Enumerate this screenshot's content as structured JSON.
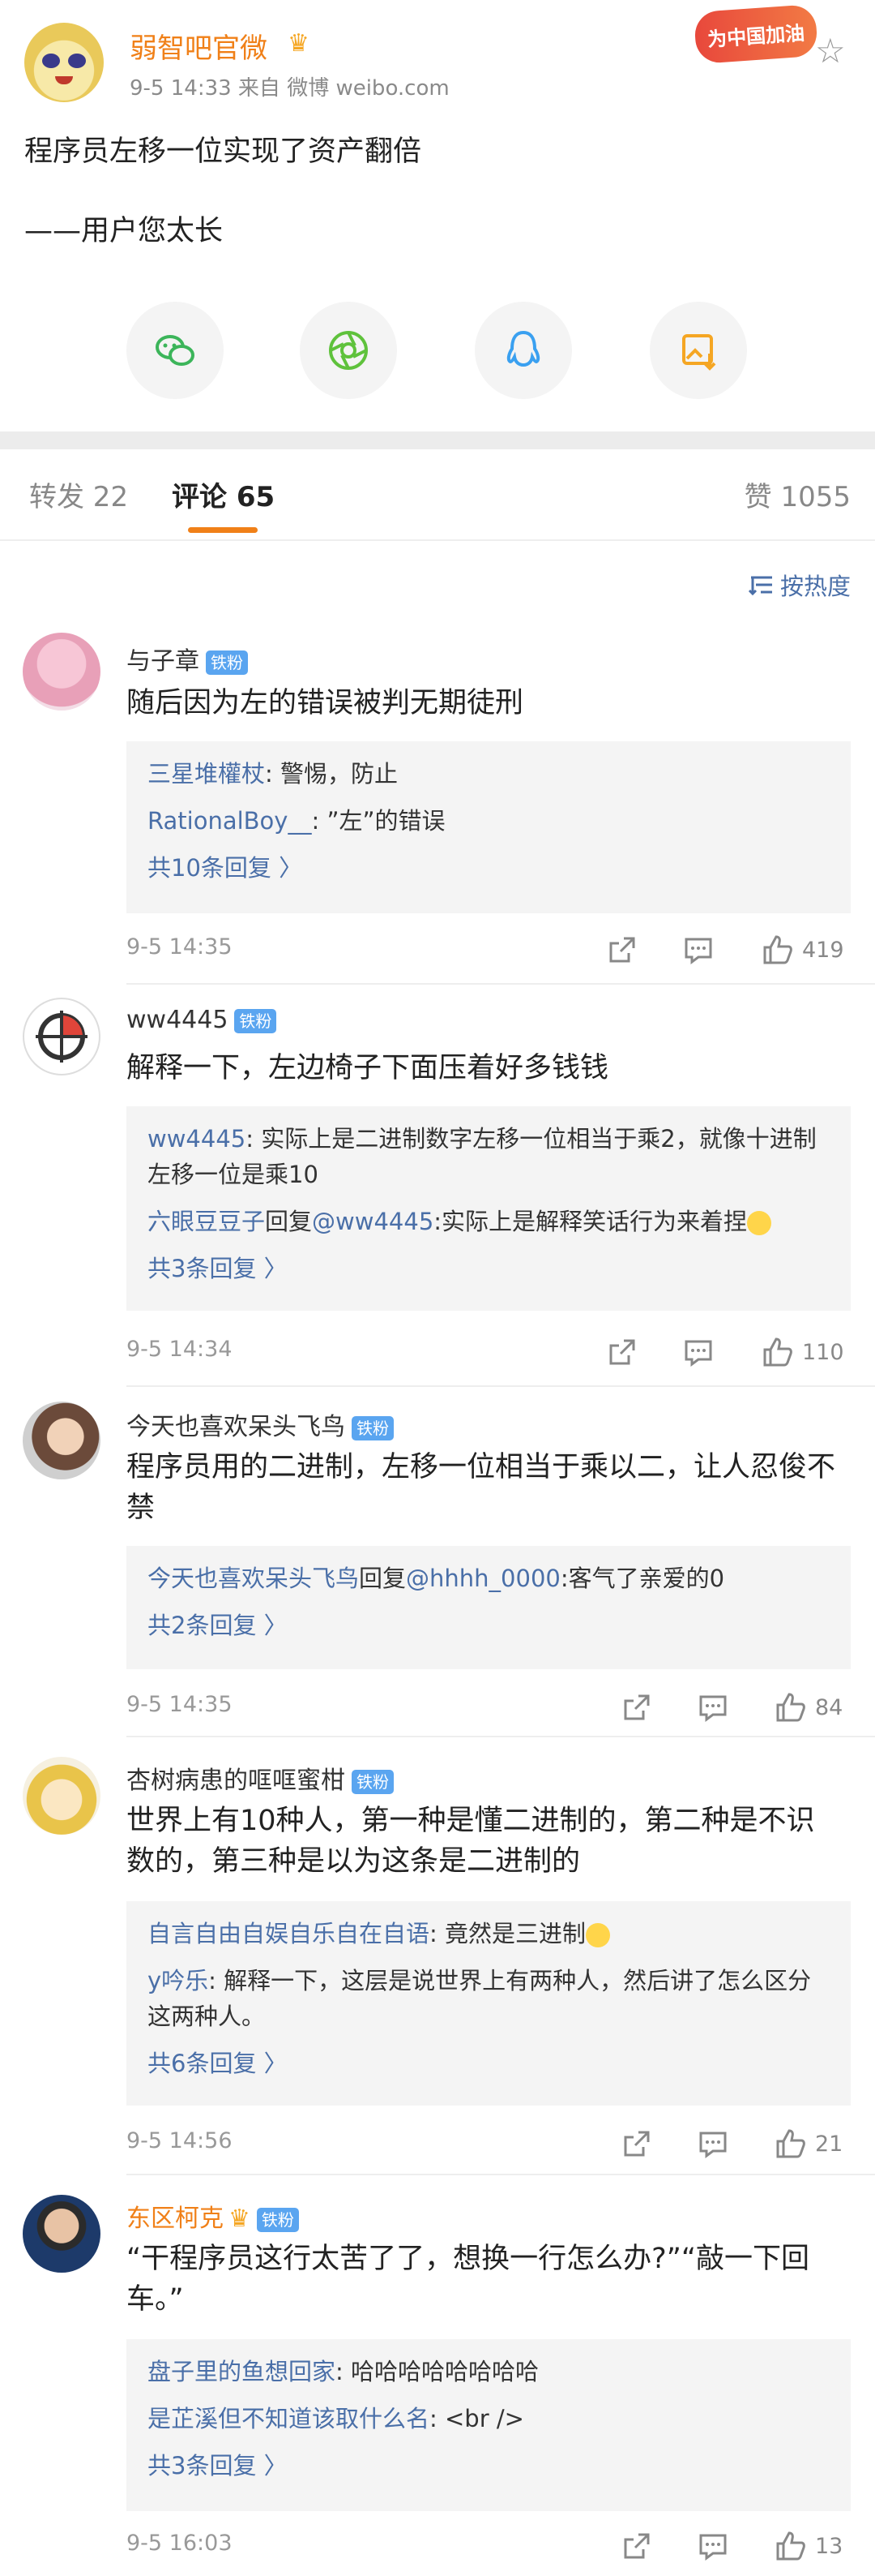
{
  "post": {
    "author": "弱智吧官微",
    "meta": "9-5 14:33   来自 微博 weibo.com",
    "badge": "为中国加油",
    "line1": "程序员左移一位实现了资产翻倍",
    "line2": "——用户您太长"
  },
  "tabs": {
    "repost": "转发 22",
    "comments": "评论 65",
    "likes": "赞 1055"
  },
  "sort_label": "按热度",
  "fan_badge": "铁粉",
  "comments": [
    {
      "name": "与子章",
      "text": "随后因为左的错误被判无期徒刑",
      "replies": [
        {
          "user": "三星堆權杖",
          "text": ": 警惕，防止"
        },
        {
          "user": "RationalBoy__",
          "text": ": ”左”的错误"
        }
      ],
      "more": "共10条回复 〉",
      "time": "9-5 14:35",
      "likes": "419"
    },
    {
      "name": "ww4445",
      "text": "解释一下，左边椅子下面压着好多钱钱",
      "replies": [
        {
          "user": "ww4445",
          "text": ": 实际上是二进制数字左移一位相当于乘2，就像十进制左移一位是乘10"
        },
        {
          "user": "六眼豆豆子",
          "mid": "回复",
          "user2": "@ww4445",
          "text": ":实际上是解释笑话行为来着捏"
        }
      ],
      "more": "共3条回复 〉",
      "time": "9-5 14:34",
      "likes": "110"
    },
    {
      "name": "今天也喜欢呆头飞鸟",
      "text": "程序员用的二进制，左移一位相当于乘以二，让人忍俊不禁",
      "replies": [
        {
          "user": "今天也喜欢呆头飞鸟",
          "mid": "回复",
          "user2": "@hhhh_0000",
          "text": ":客气了亲爱的0"
        }
      ],
      "more": "共2条回复 〉",
      "time": "9-5 14:35",
      "likes": "84"
    },
    {
      "name": "杏树病患的哐哐蜜柑",
      "text": "世界上有10种人，第一种是懂二进制的，第二种是不识数的，第三种是以为这条是二进制的",
      "replies": [
        {
          "user": "自言自由自娱自乐自在自语",
          "text": ": 竟然是三进制"
        },
        {
          "user": "y吟乐",
          "text": ": 解释一下，这层是说世界上有两种人，然后讲了怎么区分这两种人。"
        }
      ],
      "more": "共6条回复 〉",
      "time": "9-5 14:56",
      "likes": "21"
    },
    {
      "name": "东区柯克",
      "text": "“干程序员这行太苦了了，想换一行怎么办?”“敲一下回车。”",
      "replies": [
        {
          "user": "盘子里的鱼想回家",
          "text": ": 哈哈哈哈哈哈哈哈"
        },
        {
          "user": "是芷溪但不知道该取什么名",
          "text": ": <br />"
        }
      ],
      "more": "共3条回复 〉",
      "time": "9-5 16:03",
      "likes": "13"
    }
  ],
  "colors": {
    "brand": "#f08018",
    "link": "#4a6fa8",
    "fan": "#5aa5f0"
  }
}
